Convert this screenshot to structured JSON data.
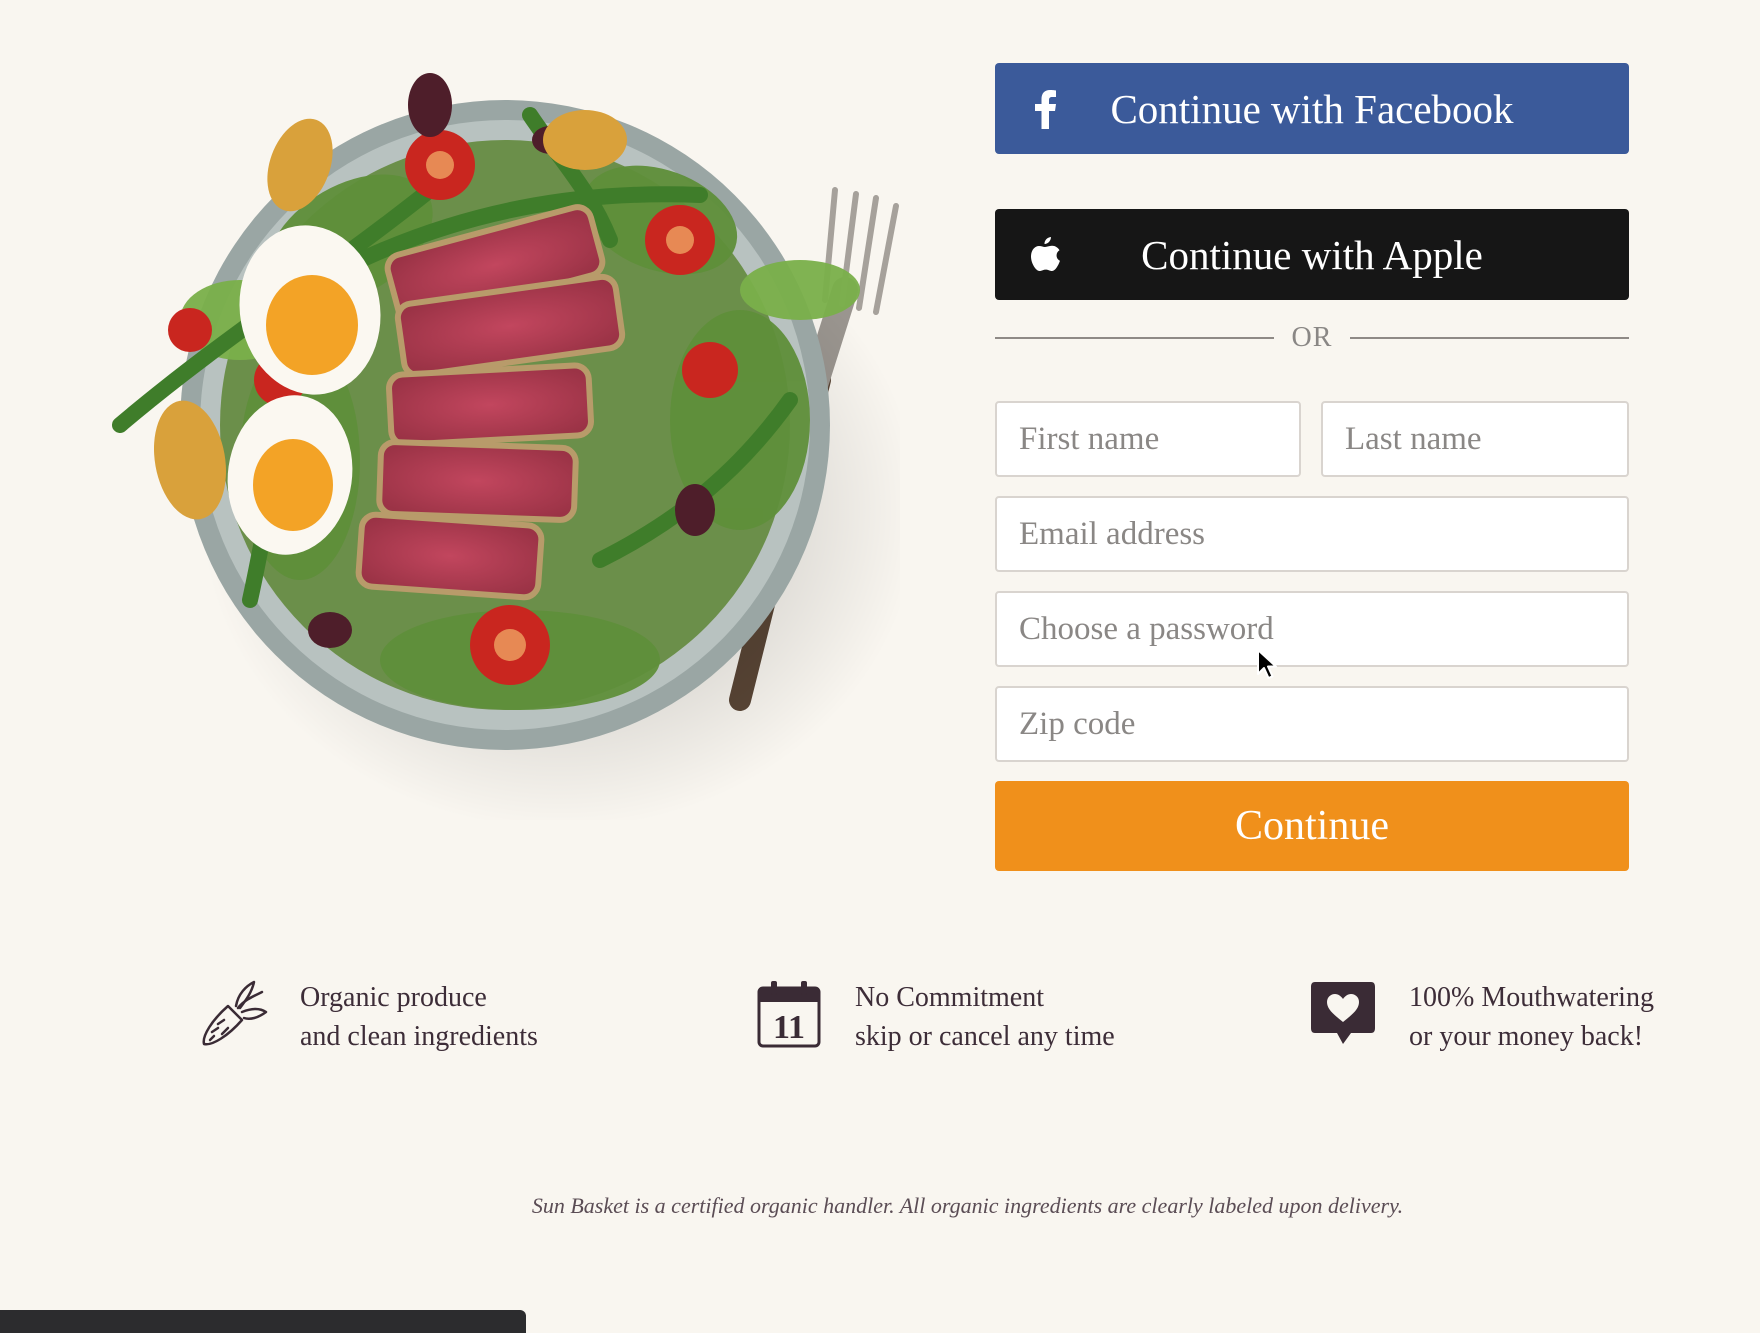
{
  "hero": {
    "image": "salad-bowl-with-seared-tuna-eggs-and-green-beans"
  },
  "social": {
    "facebook": {
      "label": "Continue with Facebook",
      "icon": "facebook-icon",
      "color": "#3b5a9a"
    },
    "apple": {
      "label": "Continue with Apple",
      "icon": "apple-icon",
      "color": "#161616"
    }
  },
  "divider": {
    "text": "OR"
  },
  "form": {
    "first_name": {
      "placeholder": "First name",
      "value": ""
    },
    "last_name": {
      "placeholder": "Last name",
      "value": ""
    },
    "email": {
      "placeholder": "Email address",
      "value": ""
    },
    "password": {
      "placeholder": "Choose a password",
      "value": ""
    },
    "zip": {
      "placeholder": "Zip code",
      "value": ""
    },
    "submit_label": "Continue",
    "submit_color": "#f0901b"
  },
  "features": [
    {
      "icon": "carrot-icon",
      "line1": "Organic produce",
      "line2": "and clean ingredients"
    },
    {
      "icon": "calendar-icon",
      "line1": "No Commitment",
      "line2": "skip or cancel any time",
      "calendar_day": "11"
    },
    {
      "icon": "heart-speech-bubble-icon",
      "line1": "100% Mouthwatering",
      "line2": "or your money back!"
    }
  ],
  "disclaimer": "Sun Basket is a certified organic handler. All organic ingredients are clearly labeled upon delivery."
}
